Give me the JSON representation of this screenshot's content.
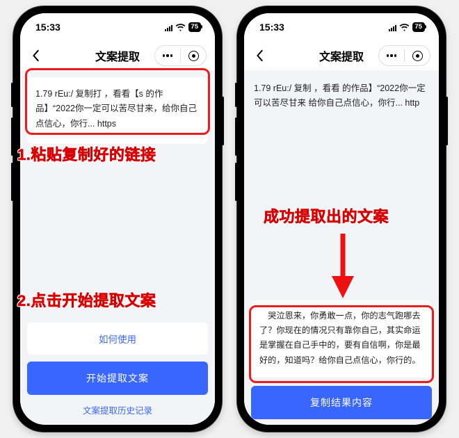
{
  "status": {
    "time": "15:33",
    "battery": "75"
  },
  "header": {
    "title": "文案提取"
  },
  "left": {
    "input_text": "1.79 rEu:/ 复制打           ，看看【s             的作品】“2022你一定可以苦尽甘来，给你自己点信心，你行... https                                 ",
    "how_button": "如何使用",
    "start_button": "开始提取文案",
    "history_link": "文案提取历史记录"
  },
  "right": {
    "input_text": "1.79 rEu:/ 复制              ，看看                的作品】“2022你一定可以苦尽甘来    给你自己点信心，你行... http                                 ",
    "result_text": "　哭泣恩来，你勇敢一点，你的志气跑哪去了？你现在的情况只有靠你自己，其实命运是掌握在自己手中的，要有自信啊，你是最好的，知道吗？给你自己点信心，你行的。",
    "copy_button": "复制结果内容"
  },
  "annotations": {
    "step1": "1.粘贴复制好的链接",
    "step2": "2.点击开始提取文案",
    "success": "成功提取出的文案"
  }
}
